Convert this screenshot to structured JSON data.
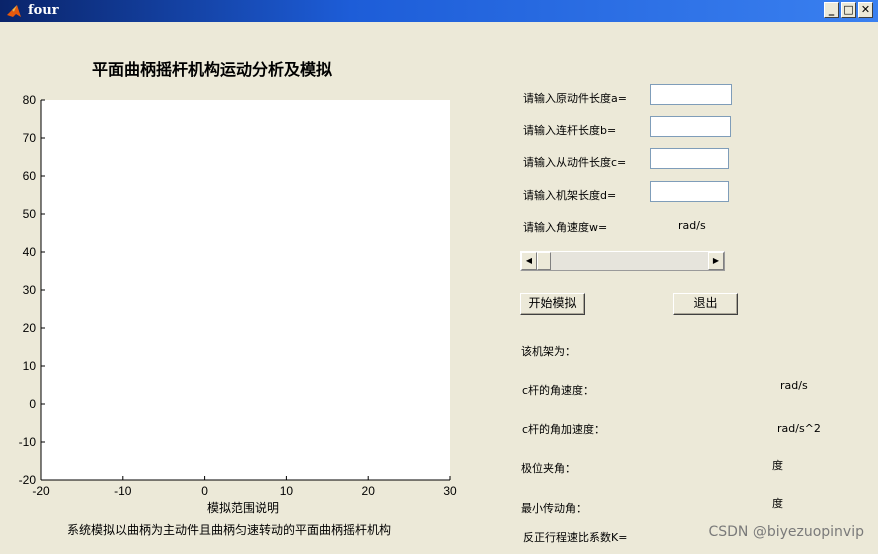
{
  "window": {
    "title": "four"
  },
  "figure": {
    "title": "平面曲柄摇杆机构运动分析及模拟",
    "xlabel": "模拟范围说明",
    "caption": "系统模拟以曲柄为主动件且曲柄匀速转动的平面曲柄摇杆机构"
  },
  "chart_data": {
    "type": "line",
    "series": [],
    "xlim": [
      -20,
      30
    ],
    "ylim": [
      -20,
      80
    ],
    "xticks": [
      -20,
      -10,
      0,
      10,
      20,
      30
    ],
    "yticks": [
      -20,
      -10,
      0,
      10,
      20,
      30,
      40,
      50,
      60,
      70,
      80
    ],
    "xlabel": "模拟范围说明",
    "ylabel": "",
    "title": "平面曲柄摇杆机构运动分析及模拟",
    "grid": false
  },
  "inputs": {
    "a_label": "请输入原动件长度a=",
    "b_label": "请输入连杆长度b=",
    "c_label": "请输入从动件长度c=",
    "d_label": "请输入机架长度d=",
    "w_label": "请输入角速度w=",
    "w_unit": "rad/s",
    "a_value": "",
    "b_value": "",
    "c_value": "",
    "d_value": ""
  },
  "slider": {
    "value": 0
  },
  "buttons": {
    "start": "开始模拟",
    "exit": "退出"
  },
  "results": {
    "frame_label": "该机架为：",
    "c_vel_label": "c杆的角速度：",
    "c_vel_unit": "rad/s",
    "c_acc_label": "c杆的角加速度：",
    "c_acc_unit": "rad/s^2",
    "limit_angle_label": "极位夹角：",
    "limit_angle_unit": "度",
    "min_trans_label": "最小传动角：",
    "min_trans_unit": "度",
    "k_label": "反正行程速比系数K="
  },
  "watermark": "CSDN @biyezuopinvip",
  "colors": {
    "titlebar": "#0a246a",
    "background": "#ece9d8",
    "axes_bg": "#ffffff"
  }
}
